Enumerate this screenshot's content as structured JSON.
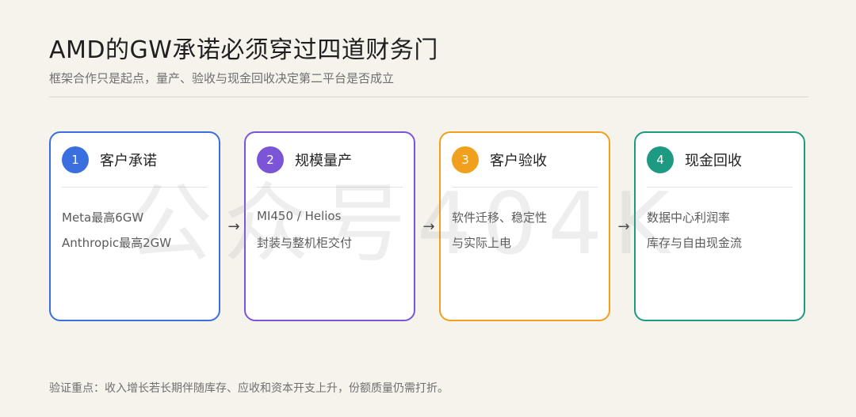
{
  "header": {
    "title": "AMD的GW承诺必须穿过四道财务门",
    "subtitle": "框架合作只是起点，量产、验收与现金回收决定第二平台是否成立"
  },
  "watermark": "公众号404K",
  "arrow_glyph": "→",
  "steps": [
    {
      "number": "1",
      "title": "客户承诺",
      "lines": [
        "Meta最高6GW",
        "Anthropic最高2GW"
      ],
      "color": "#3b6fe0"
    },
    {
      "number": "2",
      "title": "规模量产",
      "lines": [
        "MI450 / Helios",
        "封装与整机柜交付"
      ],
      "color": "#7b55d6"
    },
    {
      "number": "3",
      "title": "客户验收",
      "lines": [
        "软件迁移、稳定性",
        "与实际上电"
      ],
      "color": "#f0a01c"
    },
    {
      "number": "4",
      "title": "现金回收",
      "lines": [
        "数据中心利润率",
        "库存与自由现金流"
      ],
      "color": "#1f9a82"
    }
  ],
  "footer": "验证重点：收入增长若长期伴随库存、应收和资本开支上升，份额质量仍需打折。"
}
